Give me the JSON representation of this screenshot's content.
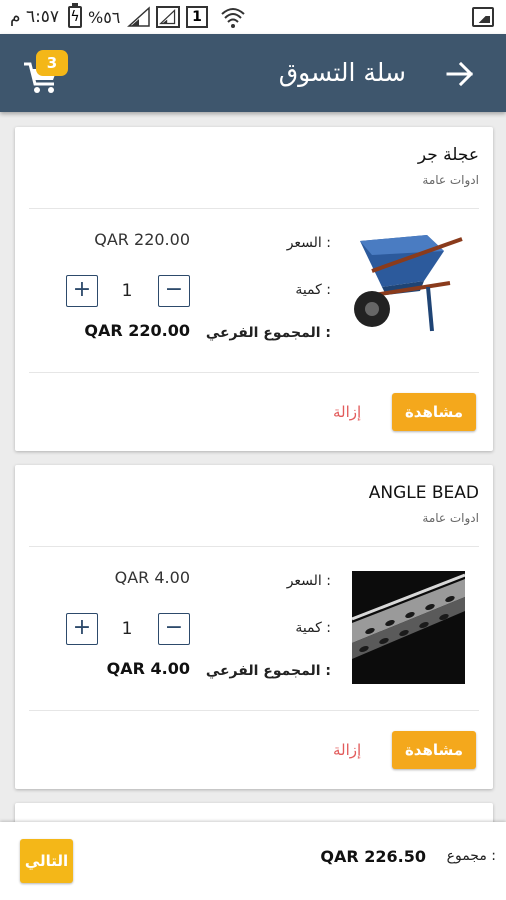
{
  "status_bar": {
    "time": "٦:٥٧ م",
    "battery_percent": "%٥٦",
    "sim_slot": "1",
    "icons": [
      "image-icon",
      "wifi-icon",
      "sim-icon",
      "signal-icon",
      "signal-icon",
      "battery-charging-icon"
    ]
  },
  "header": {
    "title": "سلة التسوق",
    "cart_count": "3",
    "back_icon": "arrow-right-icon",
    "cart_icon": "shopping-cart-icon"
  },
  "labels": {
    "price": "السعر :",
    "quantity": "كمية :",
    "subtotal": "المجموع الفرعي :",
    "view": "مشاهدة",
    "remove": "إزالة",
    "plus": "+",
    "minus": "−"
  },
  "cart_items": [
    {
      "name": "عجلة جر",
      "category": "ادوات عامة",
      "price": "QAR 220.00",
      "quantity": "1",
      "subtotal": "QAR 220.00",
      "image": "wheelbarrow-image"
    },
    {
      "name": "ANGLE BEAD",
      "category": "ادوات عامة",
      "price": "QAR 4.00",
      "quantity": "1",
      "subtotal": "QAR 4.00",
      "image": "angle-bead-image"
    }
  ],
  "footer": {
    "total_label": "مجموع :",
    "total_value": "QAR 226.50",
    "next_label": "التالي"
  },
  "colors": {
    "app_bar": "#3e566d",
    "accent": "#f4a81c",
    "badge": "#f4b718",
    "remove": "#e25b5b",
    "stepper": "#2d4a6b"
  }
}
